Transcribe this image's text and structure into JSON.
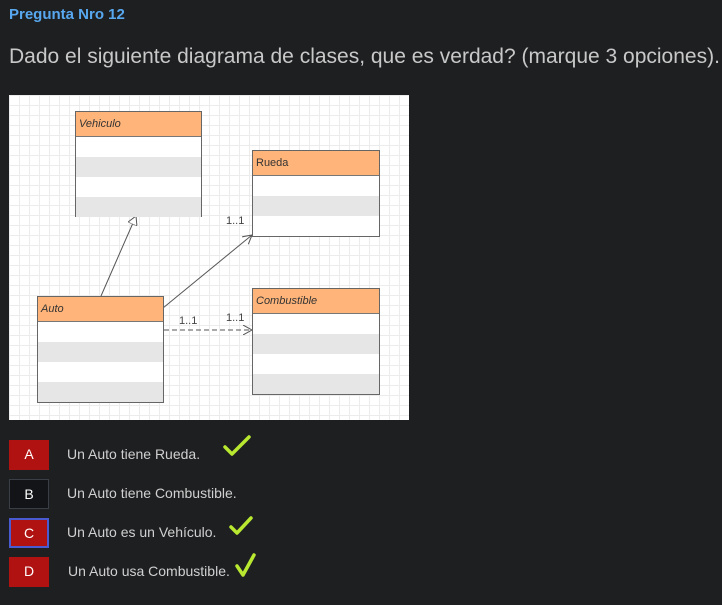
{
  "header": {
    "title": "Pregunta Nro 12"
  },
  "question": {
    "text": "Dado el siguiente diagrama de clases, que es verdad? (marque 3 opciones)."
  },
  "diagram": {
    "classes": {
      "vehiculo": "Vehiculo",
      "rueda": "Rueda",
      "auto": "Auto",
      "combustible": "Combustible"
    },
    "multiplicities": {
      "auto_rueda": "1..1",
      "auto_combustible_source": "1..1",
      "auto_combustible_target": "1..1"
    }
  },
  "options": [
    {
      "letter": "A",
      "text": "Un Auto tiene Rueda.",
      "checked": true
    },
    {
      "letter": "B",
      "text": "Un Auto tiene Combustible.",
      "checked": false
    },
    {
      "letter": "C",
      "text": "Un Auto es un Vehículo.",
      "checked": true
    },
    {
      "letter": "D",
      "text": "Un Auto usa Combustible.",
      "checked": true
    }
  ],
  "colors": {
    "accent_blue": "#58a8f0",
    "badge_red": "#b01212",
    "check_green": "#b8e830",
    "class_header": "#ffb47a"
  }
}
